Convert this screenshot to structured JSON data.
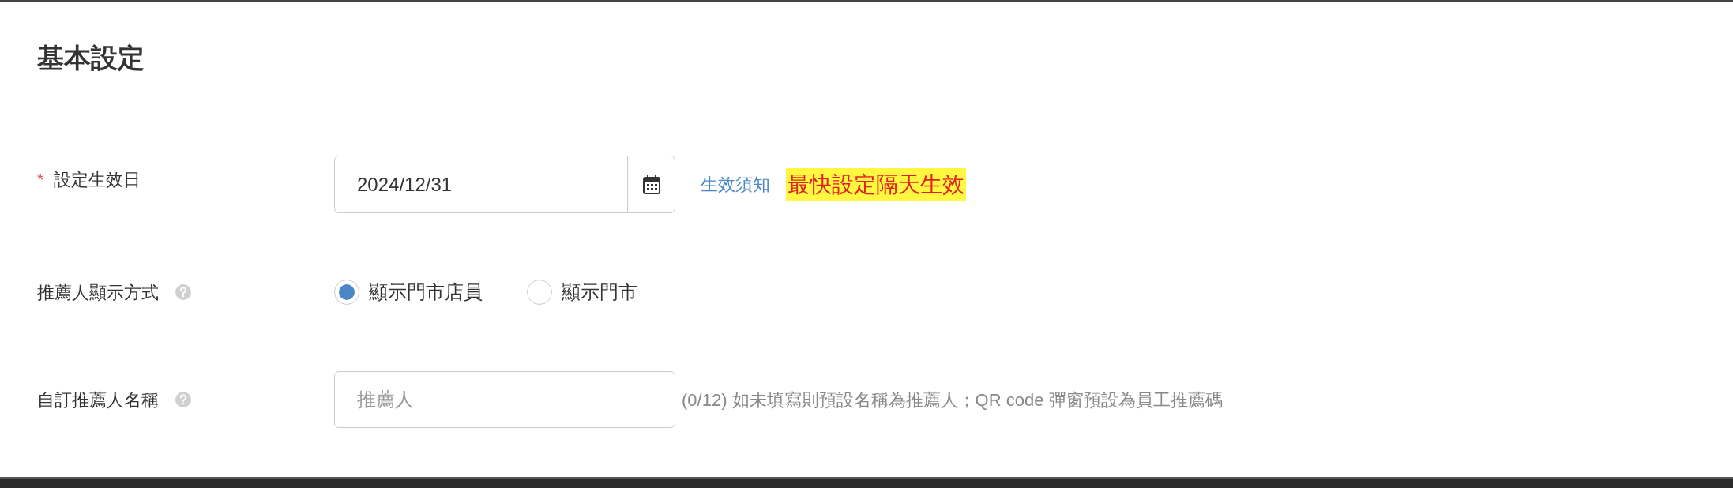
{
  "section_title": "基本設定",
  "effective_date": {
    "label": "設定生效日",
    "required_mark": "*",
    "value": "2024/12/31",
    "link": "生效須知",
    "note": "最快設定隔天生效"
  },
  "display_mode": {
    "label": "推薦人顯示方式",
    "options": [
      {
        "label": "顯示門市店員",
        "selected": true
      },
      {
        "label": "顯示門市",
        "selected": false
      }
    ]
  },
  "custom_name": {
    "label": "自訂推薦人名稱",
    "placeholder": "推薦人",
    "hint": "(0/12) 如未填寫則預設名稱為推薦人；QR code 彈窗預設為員工推薦碼"
  }
}
